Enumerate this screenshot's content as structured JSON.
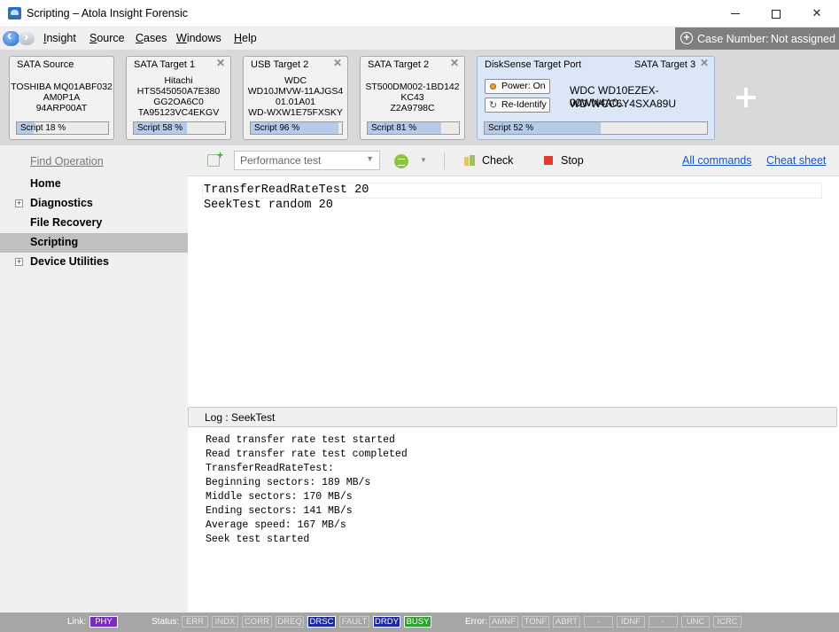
{
  "window": {
    "title": "Scripting – Atola Insight Forensic"
  },
  "menu": {
    "items": [
      "Insight",
      "Source",
      "Cases",
      "Windows",
      "Help"
    ],
    "case_label": "Case Number:",
    "case_value": "Not assigned"
  },
  "devices": [
    {
      "title": "SATA Source",
      "lines": [
        "TOSHIBA MQ01ABF032",
        "AM0P1A",
        "94ARP00AT"
      ],
      "progress_label": "Script 18 %",
      "progress": 0.18,
      "closable": false
    },
    {
      "title": "SATA Target 1",
      "lines": [
        "Hitachi",
        "HTS545050A7E380",
        "GG2OA6C0",
        "TA95123VC4EKGV"
      ],
      "progress_label": "Script 58 %",
      "progress": 0.58,
      "closable": true
    },
    {
      "title": "USB Target 2",
      "lines": [
        "WDC",
        "WD10JMVW-11AJGS4",
        "01.01A01",
        "WD-WXW1E75FXSKY"
      ],
      "progress_label": "Script 96 %",
      "progress": 0.96,
      "closable": true
    },
    {
      "title": "SATA Target 2",
      "lines": [
        "ST500DM002-1BD142",
        "KC43",
        "Z2A9798C"
      ],
      "progress_label": "Script 81 %",
      "progress": 0.81,
      "closable": true
    }
  ],
  "disksense": {
    "title": "DiskSense Target Port",
    "subtitle": "SATA Target 3",
    "power_button": "Power: On",
    "reidentify_button": "Re-Identify",
    "model": "WDC WD10EZEX-00WN4A0...",
    "serial": "WD-WCC6Y4SXA89U",
    "progress_label": "Script 52 %",
    "progress": 0.52
  },
  "sidebar": {
    "find_operation": "Find Operation",
    "items": [
      {
        "label": "Home",
        "expandable": false,
        "selected": false
      },
      {
        "label": "Diagnostics",
        "expandable": true,
        "selected": false
      },
      {
        "label": "File Recovery",
        "expandable": false,
        "selected": false
      },
      {
        "label": "Scripting",
        "expandable": false,
        "selected": true
      },
      {
        "label": "Device Utilities",
        "expandable": true,
        "selected": false
      }
    ]
  },
  "toolbar": {
    "script_select": "Performance test",
    "check_label": "Check",
    "stop_label": "Stop",
    "all_commands_link": "All commands",
    "cheat_sheet_link": "Cheat sheet"
  },
  "editor": {
    "lines": [
      "TransferReadRateTest 20",
      "SeekTest random 20"
    ]
  },
  "log": {
    "header": "Log : SeekTest",
    "lines": [
      "Read transfer rate test started",
      "Read transfer rate test completed",
      "TransferReadRateTest:",
      "Beginning sectors: 189 MB/s",
      "Middle sectors: 170 MB/s",
      "Ending sectors: 141 MB/s",
      "Average speed: 167 MB/s",
      "Seek test started"
    ]
  },
  "statusbar": {
    "link_label": "Link:",
    "link_value": "PHY",
    "status_label": "Status:",
    "status_indicators": [
      {
        "text": "ERR",
        "on": false,
        "color": ""
      },
      {
        "text": "INDX",
        "on": false,
        "color": ""
      },
      {
        "text": "CORR",
        "on": false,
        "color": ""
      },
      {
        "text": "DREQ",
        "on": false,
        "color": ""
      },
      {
        "text": "DRSC",
        "on": true,
        "color": "#1a2a9e"
      },
      {
        "text": "FAULT",
        "on": false,
        "color": ""
      },
      {
        "text": "DRDY",
        "on": true,
        "color": "#1a2a9e"
      },
      {
        "text": "BUSY",
        "on": true,
        "color": "#2ea12e"
      }
    ],
    "error_label": "Error:",
    "error_indicators": [
      "AMNF",
      "TONF",
      "ABRT",
      "-",
      "IDNF",
      "-",
      "UNC",
      "ICRC"
    ]
  },
  "colors": {
    "link_phy": "#7a2cc0",
    "progress_fill": "#b6cbe8",
    "link_blue": "#1a55c4"
  }
}
